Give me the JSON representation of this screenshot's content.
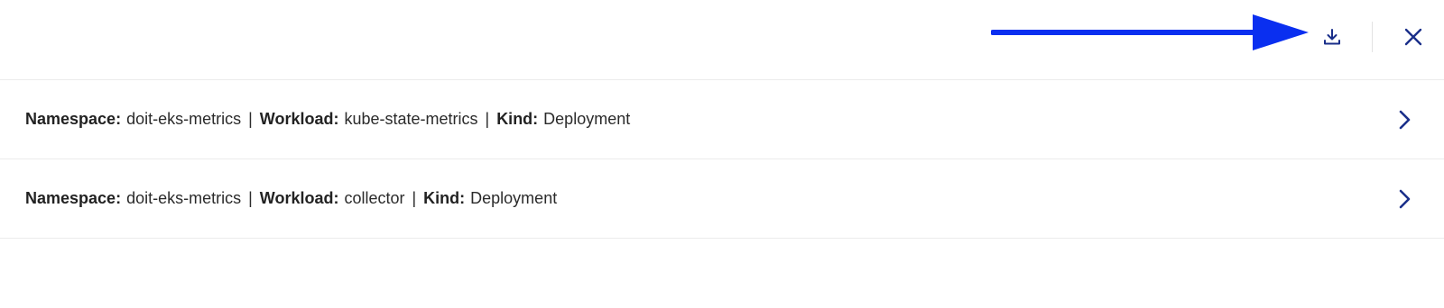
{
  "toolbar": {
    "download_icon": "download-icon",
    "close_icon": "close-icon",
    "annotation_arrow_color": "#0a2ff0",
    "icon_color": "#1a2f8a"
  },
  "rows": [
    {
      "namespace_label": "Namespace:",
      "namespace_value": "doit-eks-metrics",
      "workload_label": "Workload:",
      "workload_value": "kube-state-metrics",
      "kind_label": "Kind:",
      "kind_value": "Deployment",
      "separator": "|",
      "chevron_icon": "chevron-right-icon"
    },
    {
      "namespace_label": "Namespace:",
      "namespace_value": "doit-eks-metrics",
      "workload_label": "Workload:",
      "workload_value": "collector",
      "kind_label": "Kind:",
      "kind_value": "Deployment",
      "separator": "|",
      "chevron_icon": "chevron-right-icon"
    }
  ]
}
